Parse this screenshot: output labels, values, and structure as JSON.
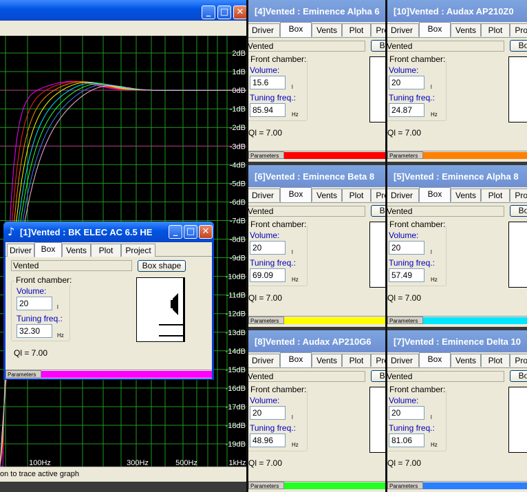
{
  "main_window": {
    "status_text": "on to trace active graph",
    "db_labels": [
      "2dB",
      "1dB",
      "0dB",
      "-1dB",
      "-2dB",
      "-3dB",
      "-4dB",
      "-5dB",
      "-6dB",
      "-7dB",
      "-8dB",
      "-9dB",
      "-10dB",
      "-11dB",
      "-12dB",
      "-13dB",
      "-14dB",
      "-15dB",
      "-16dB",
      "-17dB",
      "-18dB",
      "-19dB"
    ],
    "freq_labels": [
      "100Hz",
      "300Hz",
      "500Hz",
      "1kHz"
    ],
    "buttons": {
      "minimize": "_",
      "maximize": "□",
      "close": "✕"
    },
    "colors": {
      "grid": "#1f9a1f",
      "plot_bg": "#000000",
      "ref_line": "#c0408a"
    },
    "curve_colors": [
      "#ff00ff",
      "#ff2020",
      "#ff8a00",
      "#ffff00",
      "#00e8ff",
      "#30ff30",
      "#3a7dff",
      "#ffb0d8"
    ]
  },
  "front_window": {
    "title": "[1]Vented : BK ELEC AC 6.5 HE",
    "tabs": [
      "Driver",
      "Box",
      "Vents",
      "Plot",
      "Project"
    ],
    "active_tab": "Box",
    "box_type": "Vented",
    "box_shape_button": "Box shape",
    "front_chamber_label": "Front chamber:",
    "volume_label": "Volume:",
    "volume_value": "20",
    "volume_unit": "l",
    "tuning_label": "Tuning freq.:",
    "tuning_value": "32.30",
    "tuning_unit": "Hz",
    "ql": "Ql = 7.00",
    "parameters_label": "Parameters",
    "color": "#ff00ff",
    "title_buttons": {
      "minimize": "_",
      "maximize": "□",
      "close": "✕"
    }
  },
  "enclosures": [
    {
      "title": "[4]Vented : Eminence Alpha 6",
      "box_type": "Vented",
      "box_button": "Bo",
      "volume": "15.6",
      "tuning": "85.94",
      "ql": "Ql = 7.00",
      "color": "#ff0000"
    },
    {
      "title": "[10]Vented : Audax AP210Z0",
      "box_type": "Vented",
      "box_button": "Bo",
      "volume": "20",
      "tuning": "24.87",
      "ql": "Ql = 7.00",
      "color": "#ff8000"
    },
    {
      "title": "[6]Vented : Eminence Beta 8",
      "box_type": "Vented",
      "box_button": "Bo",
      "volume": "20",
      "tuning": "69.09",
      "ql": "Ql = 7.00",
      "color": "#ffff00"
    },
    {
      "title": "[5]Vented : Eminence Alpha 8",
      "box_type": "Vented",
      "box_button": "Bo",
      "volume": "20",
      "tuning": "57.49",
      "ql": "Ql = 7.00",
      "color": "#00e8ff"
    },
    {
      "title": "[8]Vented : Audax AP210G6",
      "box_type": "Vented",
      "box_button": "Bo",
      "volume": "20",
      "tuning": "48.96",
      "ql": "Ql = 7.00",
      "color": "#22ff22"
    },
    {
      "title": "[7]Vented : Eminence Delta 10",
      "box_type": "Vented",
      "box_button": "Bo",
      "volume": "20",
      "tuning": "81.06",
      "ql": "Ql = 7.00",
      "color": "#2a7fff"
    }
  ],
  "enclosure_common": {
    "tabs": [
      "Driver",
      "Box",
      "Vents",
      "Plot",
      "Project"
    ],
    "active_tab": "Box",
    "front_chamber_label": "Front chamber:",
    "volume_label": "Volume:",
    "volume_unit": "l",
    "tuning_label": "Tuning freq.:",
    "tuning_unit": "Hz",
    "parameters_label": "Parameters"
  }
}
